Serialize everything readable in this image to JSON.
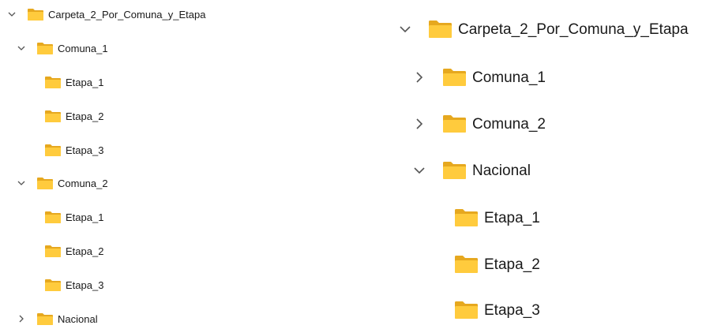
{
  "left_tree": {
    "root": {
      "label": "Carpeta_2_Por_Comuna_y_Etapa",
      "chevron": "chevron-down-icon",
      "expanded": true
    },
    "items": [
      {
        "label": "Comuna_1",
        "chevron": "chevron-down-icon",
        "expanded": true
      },
      {
        "label": "Etapa_1"
      },
      {
        "label": "Etapa_2"
      },
      {
        "label": "Etapa_3"
      },
      {
        "label": "Comuna_2",
        "chevron": "chevron-down-icon",
        "expanded": true
      },
      {
        "label": "Etapa_1"
      },
      {
        "label": "Etapa_2"
      },
      {
        "label": "Etapa_3"
      },
      {
        "label": "Nacional",
        "chevron": "chevron-right-icon",
        "expanded": false
      }
    ]
  },
  "right_tree": {
    "root": {
      "label": "Carpeta_2_Por_Comuna_y_Etapa",
      "chevron": "chevron-down-icon",
      "expanded": true
    },
    "items": [
      {
        "label": "Comuna_1",
        "chevron": "chevron-right-icon",
        "expanded": false
      },
      {
        "label": "Comuna_2",
        "chevron": "chevron-right-icon",
        "expanded": false
      },
      {
        "label": "Nacional",
        "chevron": "chevron-down-icon",
        "expanded": true
      },
      {
        "label": "Etapa_1"
      },
      {
        "label": "Etapa_2"
      },
      {
        "label": "Etapa_3"
      }
    ]
  },
  "colors": {
    "folder_back": "#e6a81f",
    "folder_front": "#ffcb3d",
    "chevron": "#555555",
    "text": "#1a1a1a"
  }
}
